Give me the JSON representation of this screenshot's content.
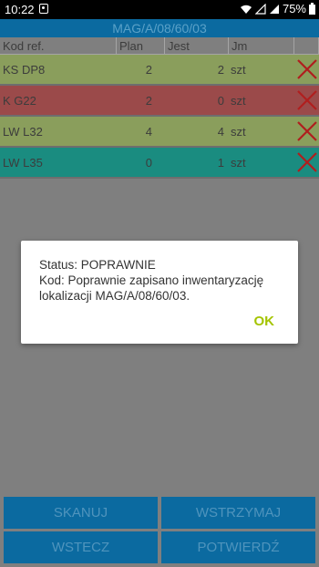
{
  "status_bar": {
    "time": "10:22",
    "battery": "75%"
  },
  "title": "MAG/A/08/60/03",
  "table": {
    "headers": [
      "Kod ref.",
      "Plan",
      "Jest",
      "Jm",
      ""
    ],
    "rows": [
      {
        "kod": "KS DP8",
        "plan": "2",
        "jest": "2",
        "jm": "szt",
        "color": "#8a9e5c"
      },
      {
        "kod": "K G22",
        "plan": "2",
        "jest": "0",
        "jm": "szt",
        "color": "#9b4a4a"
      },
      {
        "kod": "LW L32",
        "plan": "4",
        "jest": "4",
        "jm": "szt",
        "color": "#8a9e5c"
      },
      {
        "kod": "LW L35",
        "plan": "0",
        "jest": "1",
        "jm": "szt",
        "color": "#1a8c80"
      }
    ],
    "delete_icon": "close-x-icon",
    "delete_color": "#b01e1e"
  },
  "dialog": {
    "status": "Status: POPRAWNIE",
    "message": "Kod: Poprawnie zapisano inwentaryzację lokalizacji MAG/A/08/60/03.",
    "ok_label": "OK",
    "ok_color": "#a4c400"
  },
  "buttons": {
    "skanuj": "SKANUJ",
    "wstrzymaj": "WSTRZYMAJ",
    "wstecz": "WSTECZ",
    "potwierdz": "POTWIERDŹ"
  }
}
